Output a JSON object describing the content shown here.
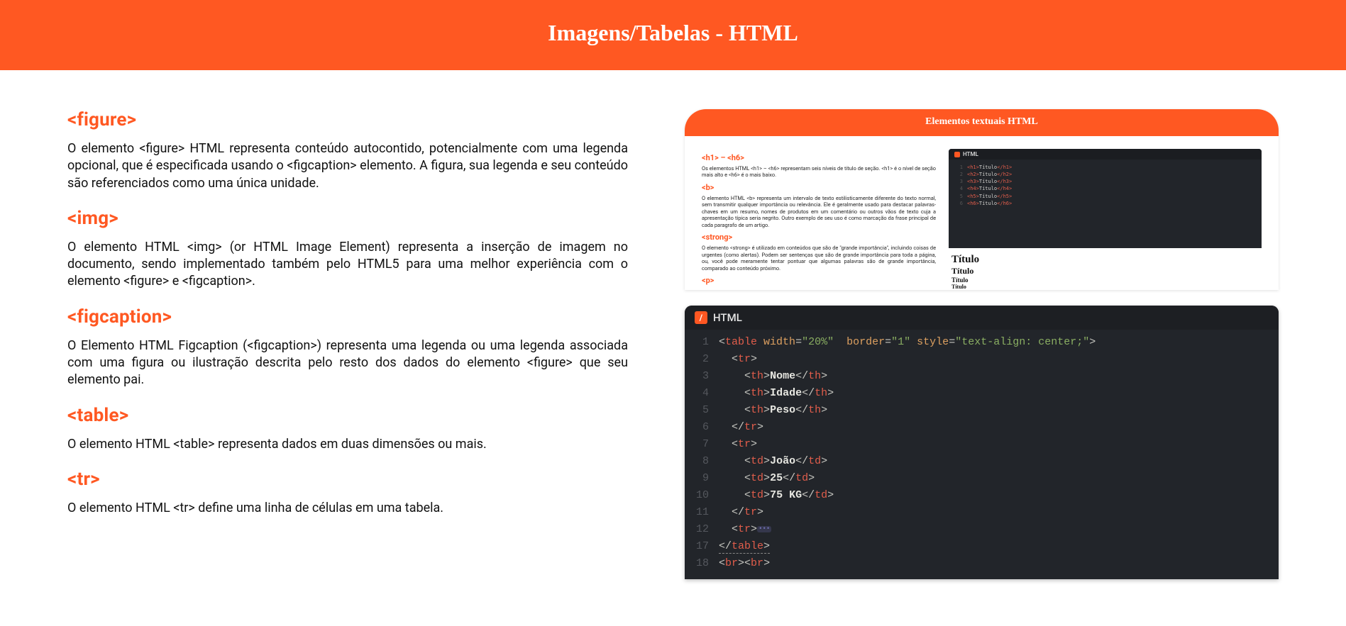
{
  "header": {
    "title": "Imagens/Tabelas - HTML"
  },
  "sections": {
    "figure": {
      "title": "<figure>",
      "body": "O elemento <figure> HTML representa conteúdo autocontido, potencialmente com uma legenda opcional, que é especificada usando o <figcaption> elemento. A figura, sua legenda e seu conteúdo são referenciados como uma única unidade."
    },
    "img": {
      "title": "<img>",
      "body": "O elemento HTML <img> (or HTML Image Element) representa a inserção de imagem no documento, sendo implementado também pelo HTML5 para uma melhor experiência com o elemento <figure> e <figcaption>."
    },
    "figcaption": {
      "title": "<figcaption>",
      "body": "O Elemento HTML Figcaption (<figcaption>) representa uma legenda ou uma legenda associada com uma figura ou ilustração descrita pelo resto dos dados do elemento <figure> que seu elemento pai."
    },
    "table": {
      "title": "<table>",
      "body": "O elemento HTML <table> representa dados em duas dimensões ou mais."
    },
    "tr": {
      "title": "<tr>",
      "body": "O elemento HTML <tr> define uma linha de células em uma tabela."
    }
  },
  "preview": {
    "header": "Elementos textuais HTML",
    "items": {
      "h": {
        "title": "<h1> – <h6>",
        "body": "Os elementos HTML <h1> – <h6> representam seis níveis de título de seção. <h1> é o nível de seção mais alto e <h6> é o mais baixo."
      },
      "b": {
        "title": "<b>",
        "body": "O elemento HTML <b> representa um intervalo de texto estilisticamente diferente do texto normal, sem transmitir qualquer importância ou relevância. Ele é geralmente usado para destacar palavras-chaves em um resumo, nomes de produtos em um comentário ou outros vãos de texto cuja a apresentação típica seria negrito. Outro exemplo de seu uso é como marcação da frase principal de cada paragrafo de um artigo."
      },
      "strong": {
        "title": "<strong>",
        "body": "O elemento <strong> é utilizado em conteúdos que são de \"grande importância\", incluindo coisas de urgentes (como alertas). Podem ser sentenças que são de grande importância para toda a página, ou, você pode meramente tentar pontuar que algumas palavras são de grande importância, comparado ao conteúdo próximo."
      },
      "p": {
        "title": "<p>"
      }
    },
    "mini_tab": "HTML",
    "mini_code": [
      {
        "n": "1",
        "tag": "h1",
        "txt": "Título"
      },
      {
        "n": "2",
        "tag": "h2",
        "txt": "Título"
      },
      {
        "n": "3",
        "tag": "h3",
        "txt": "Título"
      },
      {
        "n": "4",
        "tag": "h4",
        "txt": "Título"
      },
      {
        "n": "5",
        "tag": "h5",
        "txt": "Título"
      },
      {
        "n": "6",
        "tag": "h6",
        "txt": "Título"
      }
    ],
    "titles": [
      "Título",
      "Título",
      "Título",
      "Título"
    ]
  },
  "editor": {
    "tab": "HTML",
    "lines": [
      {
        "n": "1",
        "indent": 0,
        "html": "<span class='p'>&lt;</span><span class='t'>table</span> <span class='a'>width</span><span class='eq'>=</span><span class='s'>\"20%\"</span>  <span class='a'>border</span><span class='eq'>=</span><span class='s'>\"1\"</span> <span class='a'>style</span><span class='eq'>=</span><span class='s'>\"text-align: center;\"</span><span class='p'>&gt;</span>"
      },
      {
        "n": "2",
        "indent": 1,
        "html": "<span class='p'>&lt;</span><span class='t'>tr</span><span class='p'>&gt;</span>"
      },
      {
        "n": "3",
        "indent": 2,
        "html": "<span class='p'>&lt;</span><span class='t'>th</span><span class='p'>&gt;</span><span class='tx'>Nome</span><span class='p'>&lt;/</span><span class='t'>th</span><span class='p'>&gt;</span>"
      },
      {
        "n": "4",
        "indent": 2,
        "html": "<span class='p'>&lt;</span><span class='t'>th</span><span class='p'>&gt;</span><span class='tx'>Idade</span><span class='p'>&lt;/</span><span class='t'>th</span><span class='p'>&gt;</span>"
      },
      {
        "n": "5",
        "indent": 2,
        "html": "<span class='p'>&lt;</span><span class='t'>th</span><span class='p'>&gt;</span><span class='tx'>Peso</span><span class='p'>&lt;/</span><span class='t'>th</span><span class='p'>&gt;</span>"
      },
      {
        "n": "6",
        "indent": 1,
        "html": "<span class='p'>&lt;/</span><span class='t'>tr</span><span class='p'>&gt;</span>"
      },
      {
        "n": "7",
        "indent": 1,
        "html": "<span class='p'>&lt;</span><span class='t'>tr</span><span class='p'>&gt;</span>"
      },
      {
        "n": "8",
        "indent": 2,
        "html": "<span class='p'>&lt;</span><span class='t'>td</span><span class='p'>&gt;</span><span class='tx'>João</span><span class='p'>&lt;/</span><span class='t'>td</span><span class='p'>&gt;</span>"
      },
      {
        "n": "9",
        "indent": 2,
        "html": "<span class='p'>&lt;</span><span class='t'>td</span><span class='p'>&gt;</span><span class='tx'>25</span><span class='p'>&lt;/</span><span class='t'>td</span><span class='p'>&gt;</span>"
      },
      {
        "n": "10",
        "indent": 2,
        "html": "<span class='p'>&lt;</span><span class='t'>td</span><span class='p'>&gt;</span><span class='tx'>75 KG</span><span class='p'>&lt;/</span><span class='t'>td</span><span class='p'>&gt;</span>"
      },
      {
        "n": "11",
        "indent": 1,
        "html": "<span class='p'>&lt;/</span><span class='t'>tr</span><span class='p'>&gt;</span>"
      },
      {
        "n": "12",
        "indent": 1,
        "html": "<span class='p'>&lt;</span><span class='t'>tr</span><span class='p'>&gt;</span><span class='ell'>•••</span>"
      },
      {
        "n": "17",
        "indent": 0,
        "html": "<span class='ul'><span class='p'>&lt;/</span><span class='t'>table</span><span class='p'>&gt;</span></span>"
      },
      {
        "n": "18",
        "indent": 0,
        "html": "<span class='p'>&lt;</span><span class='t'>br</span><span class='p'>&gt;&lt;</span><span class='t'>br</span><span class='p'>&gt;</span>"
      }
    ]
  }
}
